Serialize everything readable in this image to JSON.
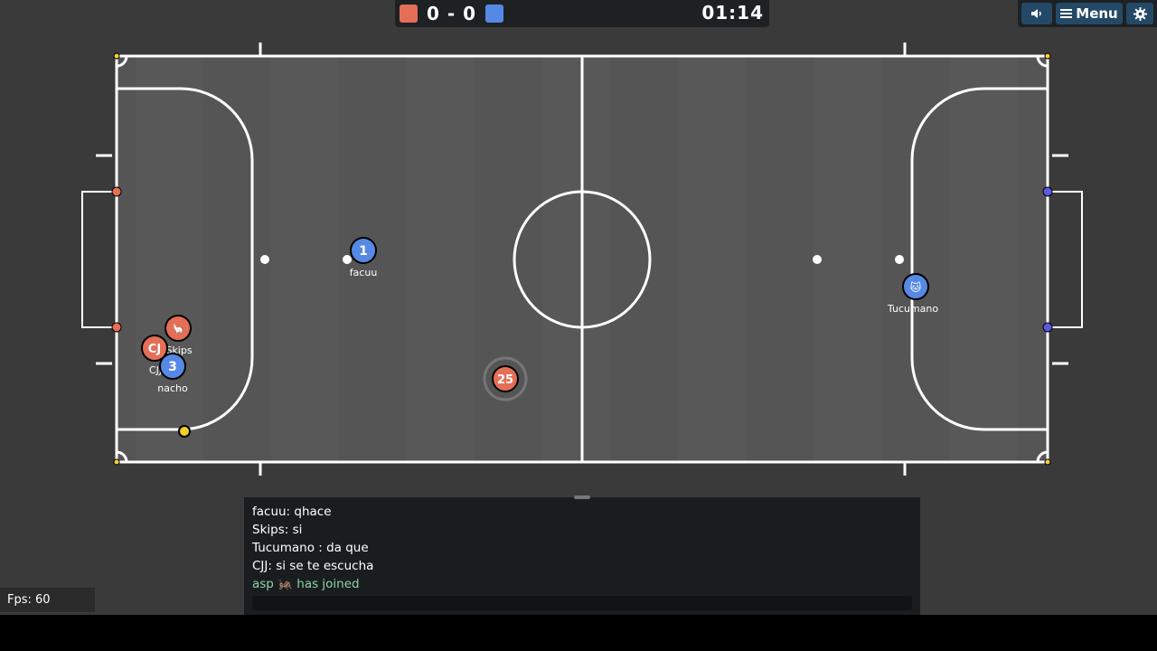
{
  "scoreboard": {
    "red_color": "#e56e56",
    "blue_color": "#5689e5",
    "red_score": "0",
    "separator": "-",
    "blue_score": "0",
    "time": "01:14"
  },
  "toolbar": {
    "sound_icon": "speaker-icon",
    "menu_icon": "hamburger-icon",
    "menu_label": "Menu",
    "settings_icon": "gear-icon",
    "button_color": "#244967"
  },
  "players": [
    {
      "name": "facuu",
      "avatar": "1",
      "team": "blue"
    },
    {
      "name": "Tucumano",
      "avatar": "🐱",
      "team": "blue"
    },
    {
      "name": "Skips",
      "avatar": "🦙",
      "team": "red"
    },
    {
      "name": "CJJ",
      "avatar": "CJ",
      "team": "red"
    },
    {
      "name": "nacho",
      "avatar": "3",
      "team": "blue"
    }
  ],
  "ball_marker": {
    "label": "25"
  },
  "chat": {
    "messages": [
      {
        "text": "facuu: qhace",
        "type": "message"
      },
      {
        "text": "Skips: si",
        "type": "message"
      },
      {
        "text": "Tucumano : da que",
        "type": "message"
      },
      {
        "text": "CJJ: si se te escucha",
        "type": "message"
      },
      {
        "text": "asp 🦗 has joined",
        "type": "join"
      }
    ],
    "input_value": ""
  },
  "fps": {
    "label": "Fps: 60"
  }
}
